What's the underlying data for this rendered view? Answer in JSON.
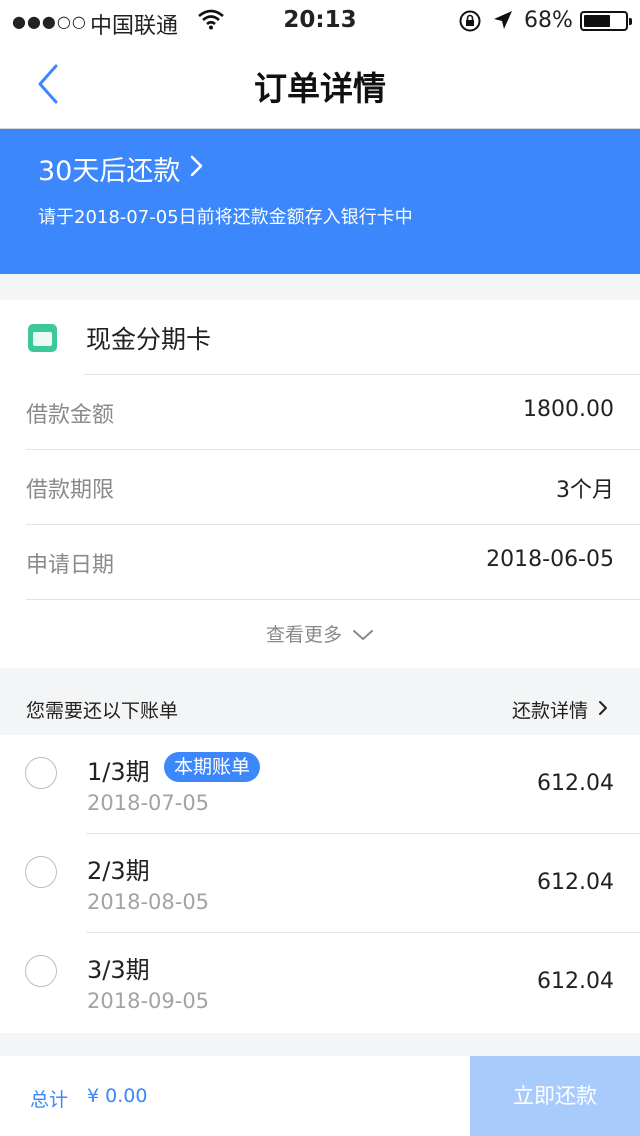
{
  "status_bar": {
    "signal": "●●●○○",
    "carrier": "中国联通",
    "time": "20:13",
    "battery_pct": "68%",
    "battery_level": 0.68
  },
  "nav": {
    "title": "订单详情",
    "back_icon": "chevron-left-icon"
  },
  "banner": {
    "headline": "30天后还款",
    "subtitle": "请于2018-07-05日前将还款金额存入银行卡中",
    "color": "#3b87fb"
  },
  "card": {
    "name": "现金分期卡",
    "icon": "card-icon",
    "rows": [
      {
        "label": "借款金额",
        "value": "1800.00"
      },
      {
        "label": "借款期限",
        "value": "3个月"
      },
      {
        "label": "申请日期",
        "value": "2018-06-05"
      }
    ],
    "more_label": "查看更多"
  },
  "bills_section": {
    "title": "您需要还以下账单",
    "details_link": "还款详情"
  },
  "bills": [
    {
      "period": "1/3期",
      "badge": "本期账单",
      "date": "2018-07-05",
      "amount": "612.04"
    },
    {
      "period": "2/3期",
      "date": "2018-08-05",
      "amount": "612.04"
    },
    {
      "period": "3/3期",
      "date": "2018-09-05",
      "amount": "612.04"
    }
  ],
  "footer": {
    "total_label": "总计",
    "total_value": "¥ 0.00",
    "pay_button": "立即还款",
    "accent_color": "#3b87fb",
    "disabled_button_color": "#a9cbfb"
  }
}
